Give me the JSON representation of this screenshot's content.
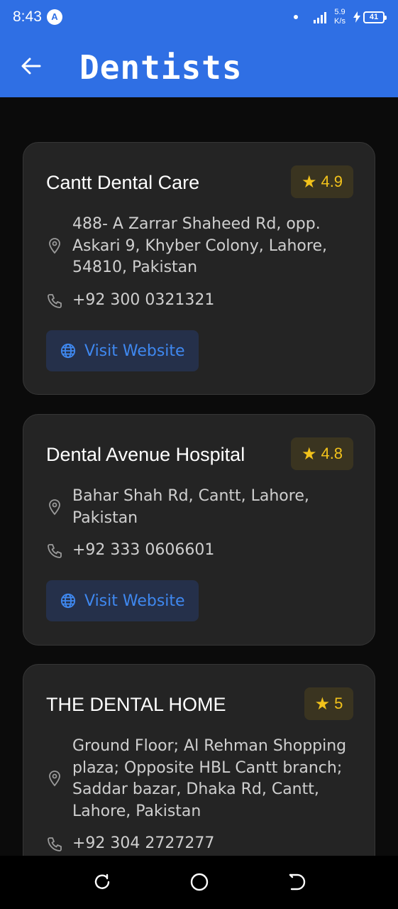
{
  "status_bar": {
    "time": "8:43",
    "app_icon_letter": "A",
    "network_speed": "5.9\nK/s",
    "network_speed_top": "5.9",
    "network_speed_unit": "K/s",
    "battery": "41"
  },
  "app_bar": {
    "title": "Dentists",
    "background_color": "#2f6fe4"
  },
  "clinics": [
    {
      "name": "Cantt Dental Care",
      "rating": "4.9",
      "address": "488- A Zarrar Shaheed Rd, opp. Askari 9, Khyber Colony, Lahore, 54810, Pakistan",
      "phone": "+92 300 0321321",
      "website_label": "Visit Website"
    },
    {
      "name": "Dental Avenue Hospital",
      "rating": "4.8",
      "address": "Bahar Shah Rd, Cantt, Lahore, Pakistan",
      "phone": "+92 333 0606601",
      "website_label": "Visit Website"
    },
    {
      "name": "THE DENTAL HOME",
      "rating": "5",
      "address": "Ground Floor; Al Rehman Shopping plaza; Opposite HBL Cantt branch; Saddar bazar, Dhaka Rd, Cantt, Lahore, Pakistan",
      "phone": "+92 304 2727277"
    }
  ],
  "colors": {
    "accent": "#2f6fe4",
    "rating_star": "#f2c21b",
    "link": "#3f88f0",
    "card_bg": "#242424"
  },
  "icons": {
    "back": "arrow-left-icon",
    "location": "map-pin-icon",
    "phone": "phone-icon",
    "website": "globe-icon",
    "rating": "star-icon",
    "nav_recents": "recents-icon",
    "nav_home": "home-icon",
    "nav_back": "back-icon"
  }
}
